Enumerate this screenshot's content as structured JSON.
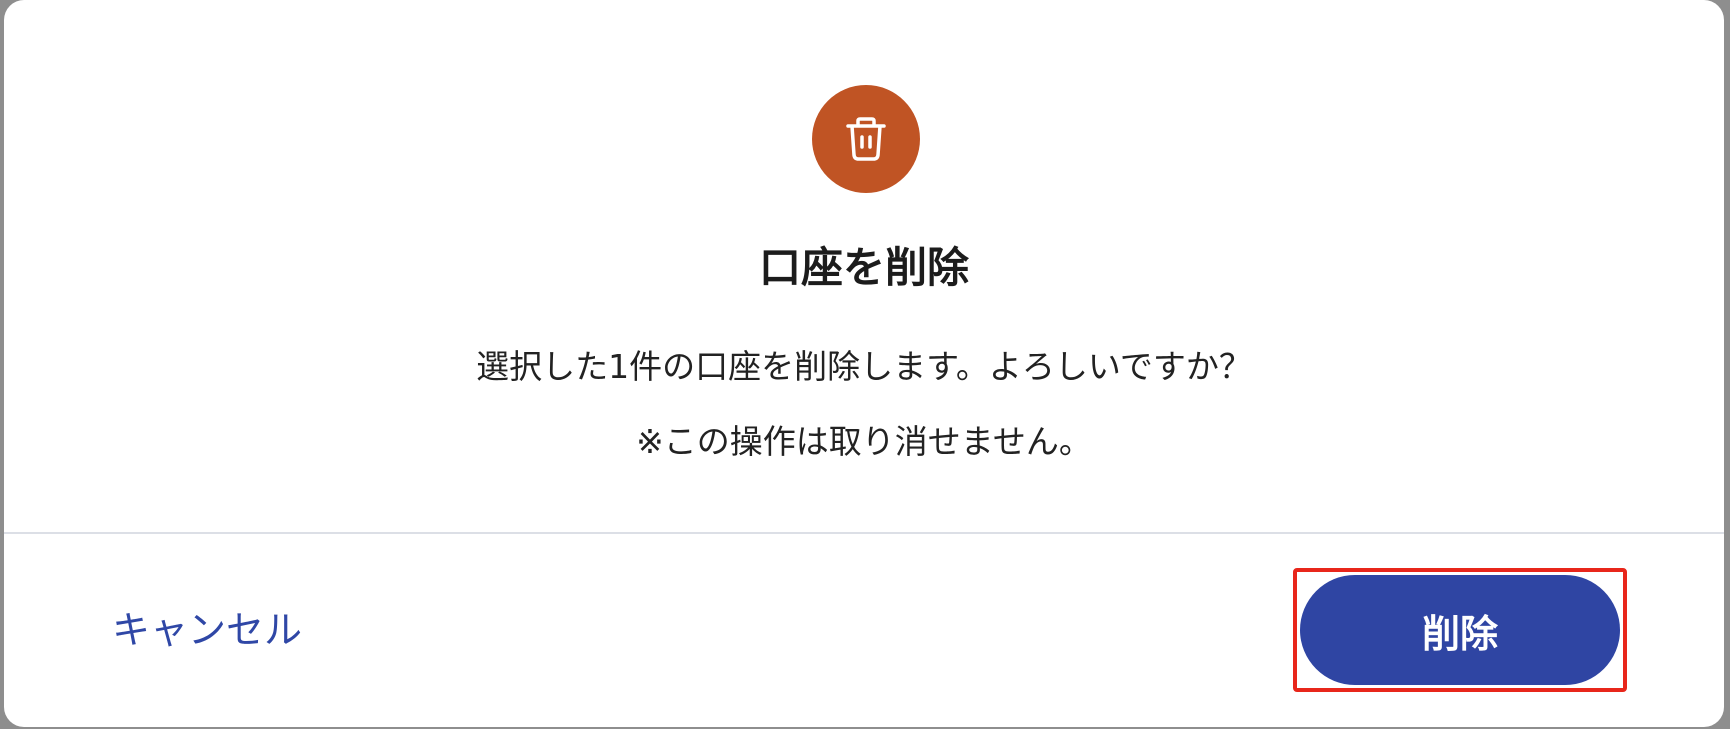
{
  "dialog": {
    "icon": "trash-icon",
    "icon_color": "#c05424",
    "title": "口座を削除",
    "message": "選択した1件の口座を削除します。よろしいですか？",
    "warning": "※この操作は取り消せません。"
  },
  "actions": {
    "cancel_label": "キャンセル",
    "delete_label": "削除",
    "primary_color": "#2f45a3",
    "highlight_color": "#e8261b"
  }
}
